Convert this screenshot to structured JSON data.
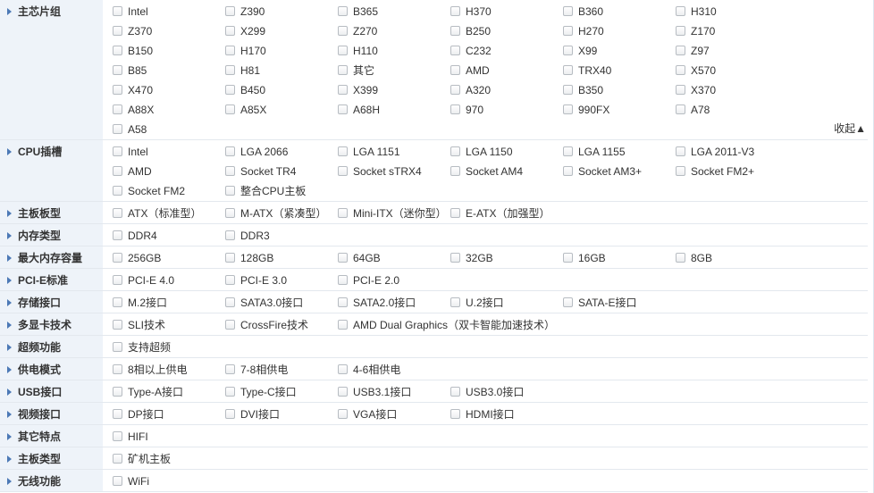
{
  "filters": [
    {
      "title": "主芯片组",
      "options": [
        "Intel",
        "Z390",
        "B365",
        "H370",
        "B360",
        "H310",
        "Z370",
        "X299",
        "Z270",
        "B250",
        "H270",
        "Z170",
        "B150",
        "H170",
        "H110",
        "C232",
        "X99",
        "Z97",
        "B85",
        "H81",
        "其它",
        "AMD",
        "TRX40",
        "X570",
        "X470",
        "B450",
        "X399",
        "A320",
        "B350",
        "X370",
        "A88X",
        "A85X",
        "A68H",
        "970",
        "990FX",
        "A78",
        "A58"
      ],
      "collapse_label": "收起▲"
    },
    {
      "title": "CPU插槽",
      "options": [
        "Intel",
        "LGA 2066",
        "LGA 1151",
        "LGA 1150",
        "LGA 1155",
        "LGA 2011-V3",
        "AMD",
        "Socket TR4",
        "Socket sTRX4",
        "Socket AM4",
        "Socket AM3+",
        "Socket FM2+",
        "Socket FM2",
        "整合CPU主板"
      ]
    },
    {
      "title": "主板板型",
      "options": [
        "ATX（标准型）",
        "M-ATX（紧凑型）",
        "Mini-ITX（迷你型）",
        "E-ATX（加强型）"
      ]
    },
    {
      "title": "内存类型",
      "options": [
        "DDR4",
        "DDR3"
      ]
    },
    {
      "title": "最大内存容量",
      "options": [
        "256GB",
        "128GB",
        "64GB",
        "32GB",
        "16GB",
        "8GB"
      ]
    },
    {
      "title": "PCI-E标准",
      "options": [
        "PCI-E 4.0",
        "PCI-E 3.0",
        "PCI-E 2.0"
      ]
    },
    {
      "title": "存储接口",
      "options": [
        "M.2接口",
        "SATA3.0接口",
        "SATA2.0接口",
        "U.2接口",
        "SATA-E接口"
      ]
    },
    {
      "title": "多显卡技术",
      "options": [
        "SLI技术",
        "CrossFire技术",
        "AMD Dual Graphics（双卡智能加速技术）"
      ]
    },
    {
      "title": "超频功能",
      "options": [
        "支持超频"
      ]
    },
    {
      "title": "供电模式",
      "options": [
        "8相以上供电",
        "7-8相供电",
        "4-6相供电"
      ]
    },
    {
      "title": "USB接口",
      "options": [
        "Type-A接口",
        "Type-C接口",
        "USB3.1接口",
        "USB3.0接口"
      ]
    },
    {
      "title": "视频接口",
      "options": [
        "DP接口",
        "DVI接口",
        "VGA接口",
        "HDMI接口"
      ]
    },
    {
      "title": "其它特点",
      "options": [
        "HIFI"
      ]
    },
    {
      "title": "主板类型",
      "options": [
        "矿机主板"
      ]
    },
    {
      "title": "无线功能",
      "options": [
        "WiFi"
      ]
    }
  ]
}
